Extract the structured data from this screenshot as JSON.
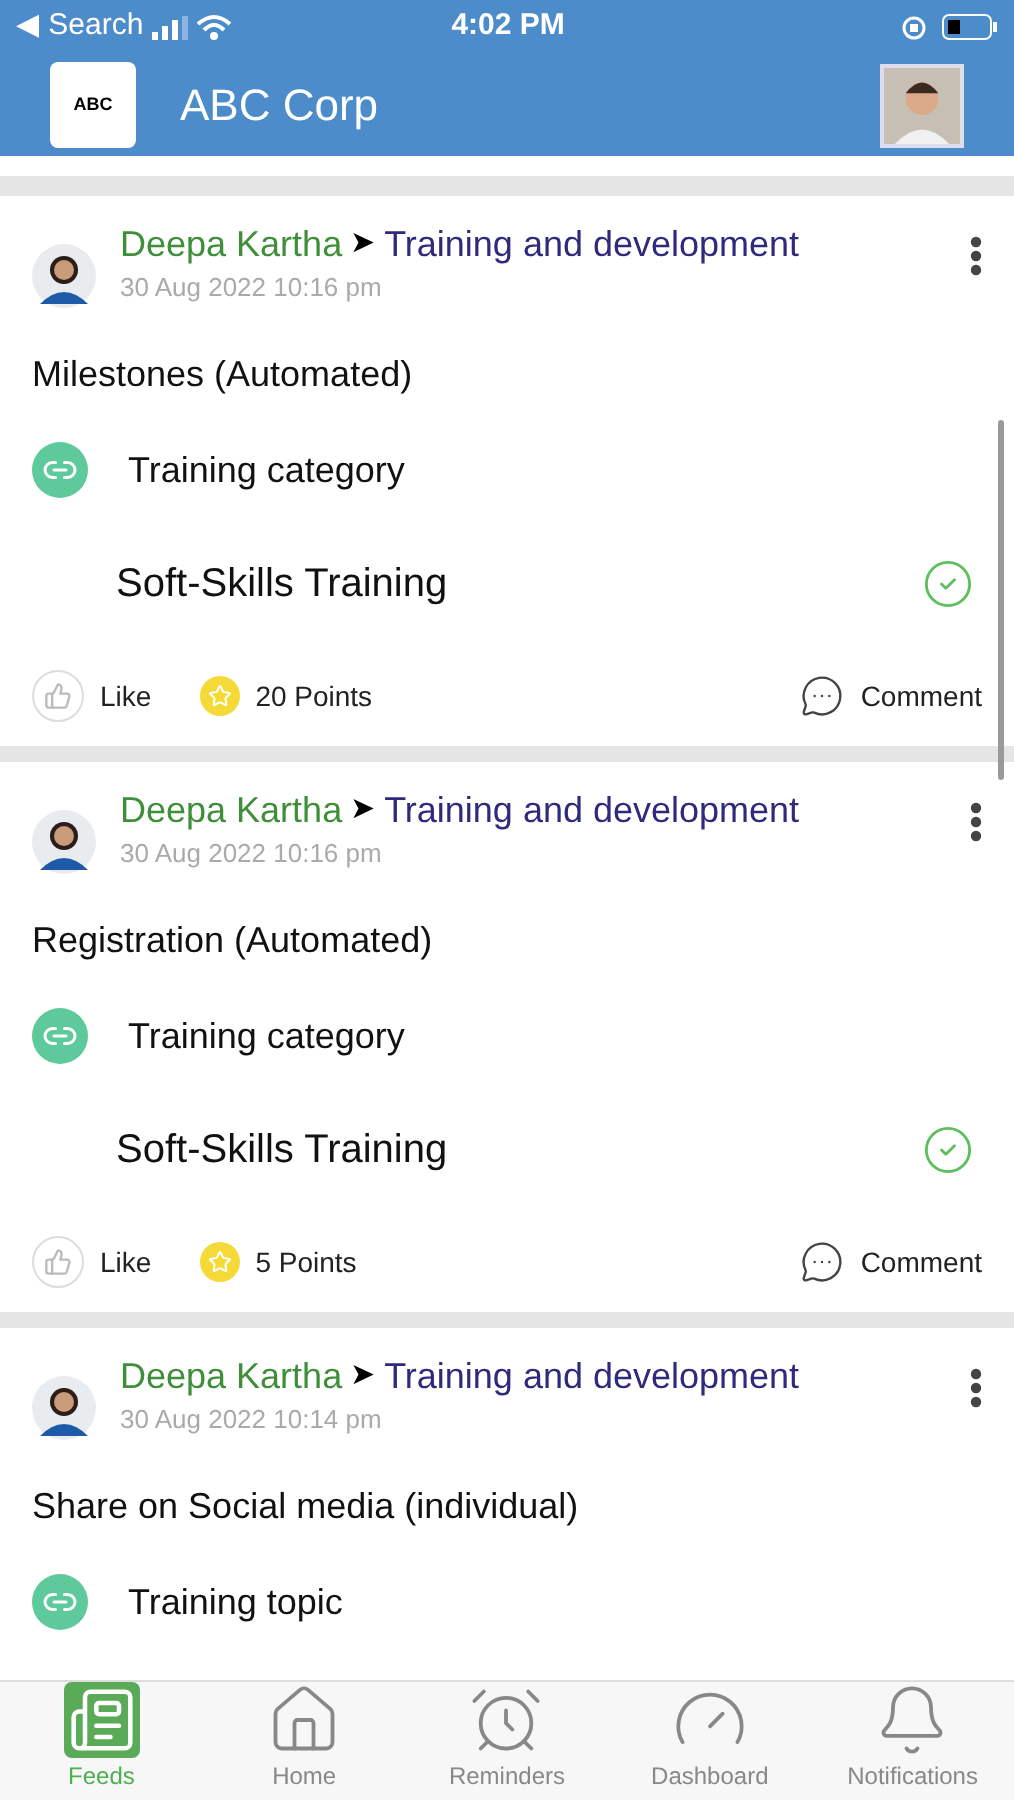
{
  "status_bar": {
    "back": "◀ Search",
    "time": "4:02 PM"
  },
  "header": {
    "logo": "ABC",
    "title": "ABC Corp"
  },
  "posts": [
    {
      "author": "Deepa Kartha",
      "arrow": "➤",
      "group": "Training and development",
      "date": "30 Aug 2022 10:16 pm",
      "title": "Milestones (Automated)",
      "field_label": "Training category",
      "value": "Soft-Skills Training",
      "completed": true,
      "like": "Like",
      "points": "20 Points",
      "comment": "Comment"
    },
    {
      "author": "Deepa Kartha",
      "arrow": "➤",
      "group": "Training and development",
      "date": "30 Aug 2022 10:16 pm",
      "title": "Registration (Automated)",
      "field_label": "Training category",
      "value": "Soft-Skills Training",
      "completed": true,
      "like": "Like",
      "points": "5 Points",
      "comment": "Comment"
    },
    {
      "author": "Deepa Kartha",
      "arrow": "➤",
      "group": "Training and development",
      "date": "30 Aug 2022 10:14 pm",
      "title": "Share on Social media (individual)",
      "field_label": "Training topic"
    }
  ],
  "tabs": [
    {
      "kind": "feeds",
      "label": "Feeds",
      "selected": true
    },
    {
      "kind": "home",
      "label": "Home",
      "selected": false
    },
    {
      "kind": "reminders",
      "label": "Reminders",
      "selected": false
    },
    {
      "kind": "dashboard",
      "label": "Dashboard",
      "selected": false
    },
    {
      "kind": "notifications",
      "label": "Notifications",
      "selected": false
    }
  ]
}
